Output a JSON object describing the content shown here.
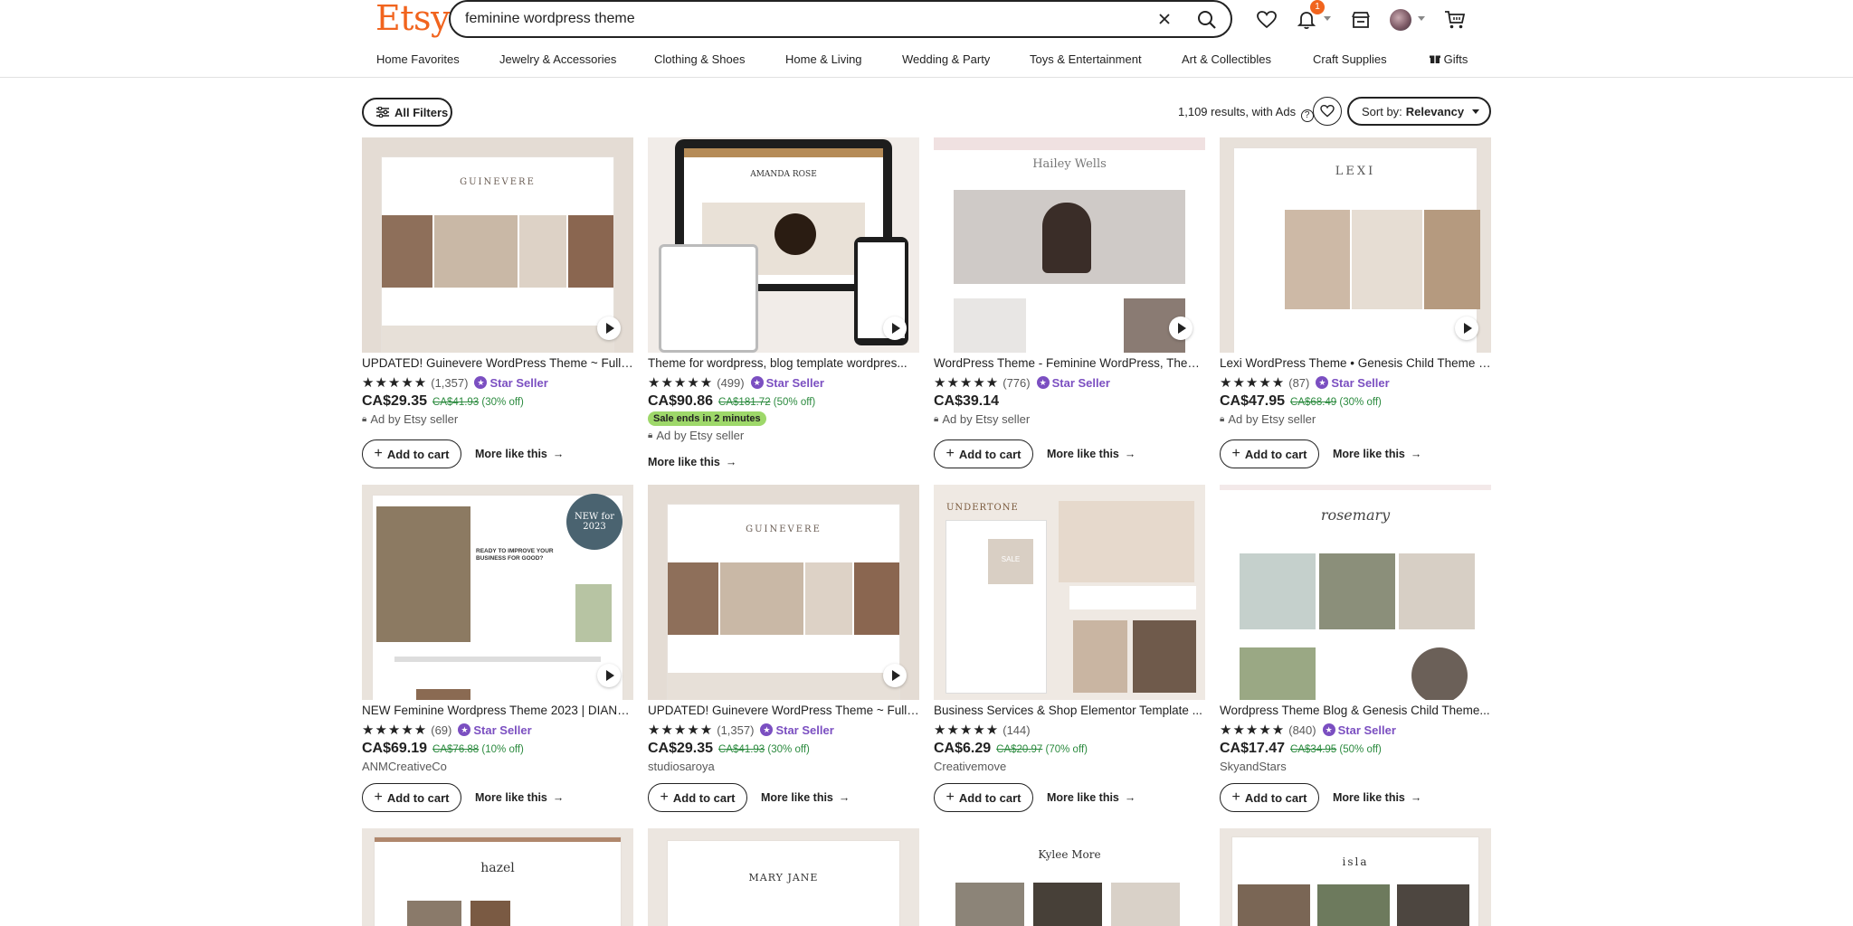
{
  "header": {
    "logo": "Etsy",
    "search_value": "feminine wordpress theme",
    "notification_count": "1"
  },
  "categories": [
    "Home Favorites",
    "Jewelry & Accessories",
    "Clothing & Shoes",
    "Home & Living",
    "Wedding & Party",
    "Toys & Entertainment",
    "Art & Collectibles",
    "Craft Supplies",
    "Gifts"
  ],
  "toolbar": {
    "filters_label": "All Filters",
    "results_text": "1,109 results, with Ads",
    "sort_prefix": "Sort by:",
    "sort_value": "Relevancy"
  },
  "listings": [
    {
      "title": "UPDATED! Guinevere WordPress Theme ~ Fully ...",
      "count": "(1,357)",
      "star_seller": "Star Seller",
      "price": "CA$29.35",
      "original": "CA$41.93",
      "discount": "(30% off)",
      "seller_line": "Ad by Etsy seller",
      "add_label": "Add to cart",
      "more_label": "More like this",
      "thumb_text": "GUINEVERE"
    },
    {
      "title": "Theme for wordpress, blog template wordpres...",
      "count": "(499)",
      "star_seller": "Star Seller",
      "price": "CA$90.86",
      "original": "CA$181.72",
      "discount": "(50% off)",
      "sale_badge": "Sale ends in 2 minutes",
      "seller_line": "Ad by Etsy seller",
      "more_label": "More like this",
      "thumb_text": "AMANDA ROSE"
    },
    {
      "title": "WordPress Theme - Feminine WordPress, Them...",
      "count": "(776)",
      "star_seller": "Star Seller",
      "price": "CA$39.14",
      "seller_line": "Ad by Etsy seller",
      "add_label": "Add to cart",
      "more_label": "More like this",
      "thumb_text": "Hailey Wells"
    },
    {
      "title": "Lexi WordPress Theme • Genesis Child Theme •...",
      "count": "(87)",
      "star_seller": "Star Seller",
      "price": "CA$47.95",
      "original": "CA$68.49",
      "discount": "(30% off)",
      "seller_line": "Ad by Etsy seller",
      "add_label": "Add to cart",
      "more_label": "More like this",
      "thumb_text": "LEXI"
    },
    {
      "title": "NEW Feminine Wordpress Theme 2023 | DIANA...",
      "count": "(69)",
      "star_seller": "Star Seller",
      "price": "CA$69.19",
      "original": "CA$76.88",
      "discount": "(10% off)",
      "seller_line": "ANMCreativeCo",
      "add_label": "Add to cart",
      "more_label": "More like this",
      "thumb_text": "NEW for 2023",
      "thumb_text2": "READY TO IMPROVE YOUR BUSINESS FOR GOOD?"
    },
    {
      "title": "UPDATED! Guinevere WordPress Theme ~ Fully ...",
      "count": "(1,357)",
      "star_seller": "Star Seller",
      "price": "CA$29.35",
      "original": "CA$41.93",
      "discount": "(30% off)",
      "seller_line": "studiosaroya",
      "add_label": "Add to cart",
      "more_label": "More like this",
      "thumb_text": "GUINEVERE"
    },
    {
      "title": "Business Services & Shop Elementor Template ...",
      "count": "(144)",
      "price": "CA$6.29",
      "original": "CA$20.97",
      "discount": "(70% off)",
      "seller_line": "Creativemove",
      "add_label": "Add to cart",
      "more_label": "More like this",
      "thumb_text": "UNDERTONE",
      "thumb_text2": "SALE"
    },
    {
      "title": "Wordpress Theme Blog & Genesis Child Theme...",
      "count": "(840)",
      "star_seller": "Star Seller",
      "price": "CA$17.47",
      "original": "CA$34.95",
      "discount": "(50% off)",
      "seller_line": "SkyandStars",
      "add_label": "Add to cart",
      "more_label": "More like this",
      "thumb_text": "rosemary"
    },
    {
      "thumb_text": "hazel"
    },
    {
      "thumb_text": "MARY JANE"
    },
    {
      "thumb_text": "Kylee More"
    },
    {
      "thumb_text": "isla"
    }
  ],
  "colors": {
    "brand": "#f1641e",
    "star_seller": "#7b4fc1",
    "discount": "#2b8a3e",
    "sale_badge": "#9ed86a"
  }
}
